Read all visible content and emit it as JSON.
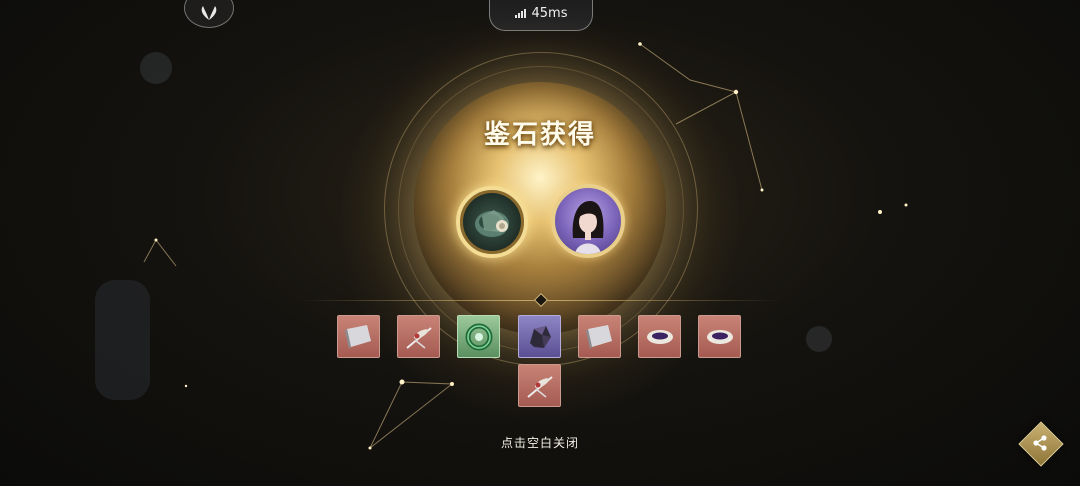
{
  "hud": {
    "ping_text": "45ms"
  },
  "reward_panel": {
    "title": "鉴石获得",
    "hint": "点击空白关闭"
  },
  "tokens": [
    {
      "name": "jade-stone-token",
      "icon": "jade-stone-icon"
    },
    {
      "name": "character-portrait-token",
      "icon": "character-portrait-icon"
    }
  ],
  "items": [
    {
      "rarity": "red",
      "icon": "silver-plate-icon"
    },
    {
      "rarity": "red",
      "icon": "hairpin-icon"
    },
    {
      "rarity": "green",
      "icon": "jade-ring-icon"
    },
    {
      "rarity": "purple",
      "icon": "dark-ore-icon"
    },
    {
      "rarity": "red",
      "icon": "silver-plate-icon"
    },
    {
      "rarity": "red",
      "icon": "purple-bowl-icon"
    },
    {
      "rarity": "red",
      "icon": "purple-bowl-icon"
    },
    {
      "rarity": "red",
      "icon": "hairpin-icon"
    }
  ],
  "colors": {
    "gold": "#e6c171",
    "item_red": "#c88476",
    "item_green": "#9cc99b",
    "item_purple": "#8d86c4"
  }
}
